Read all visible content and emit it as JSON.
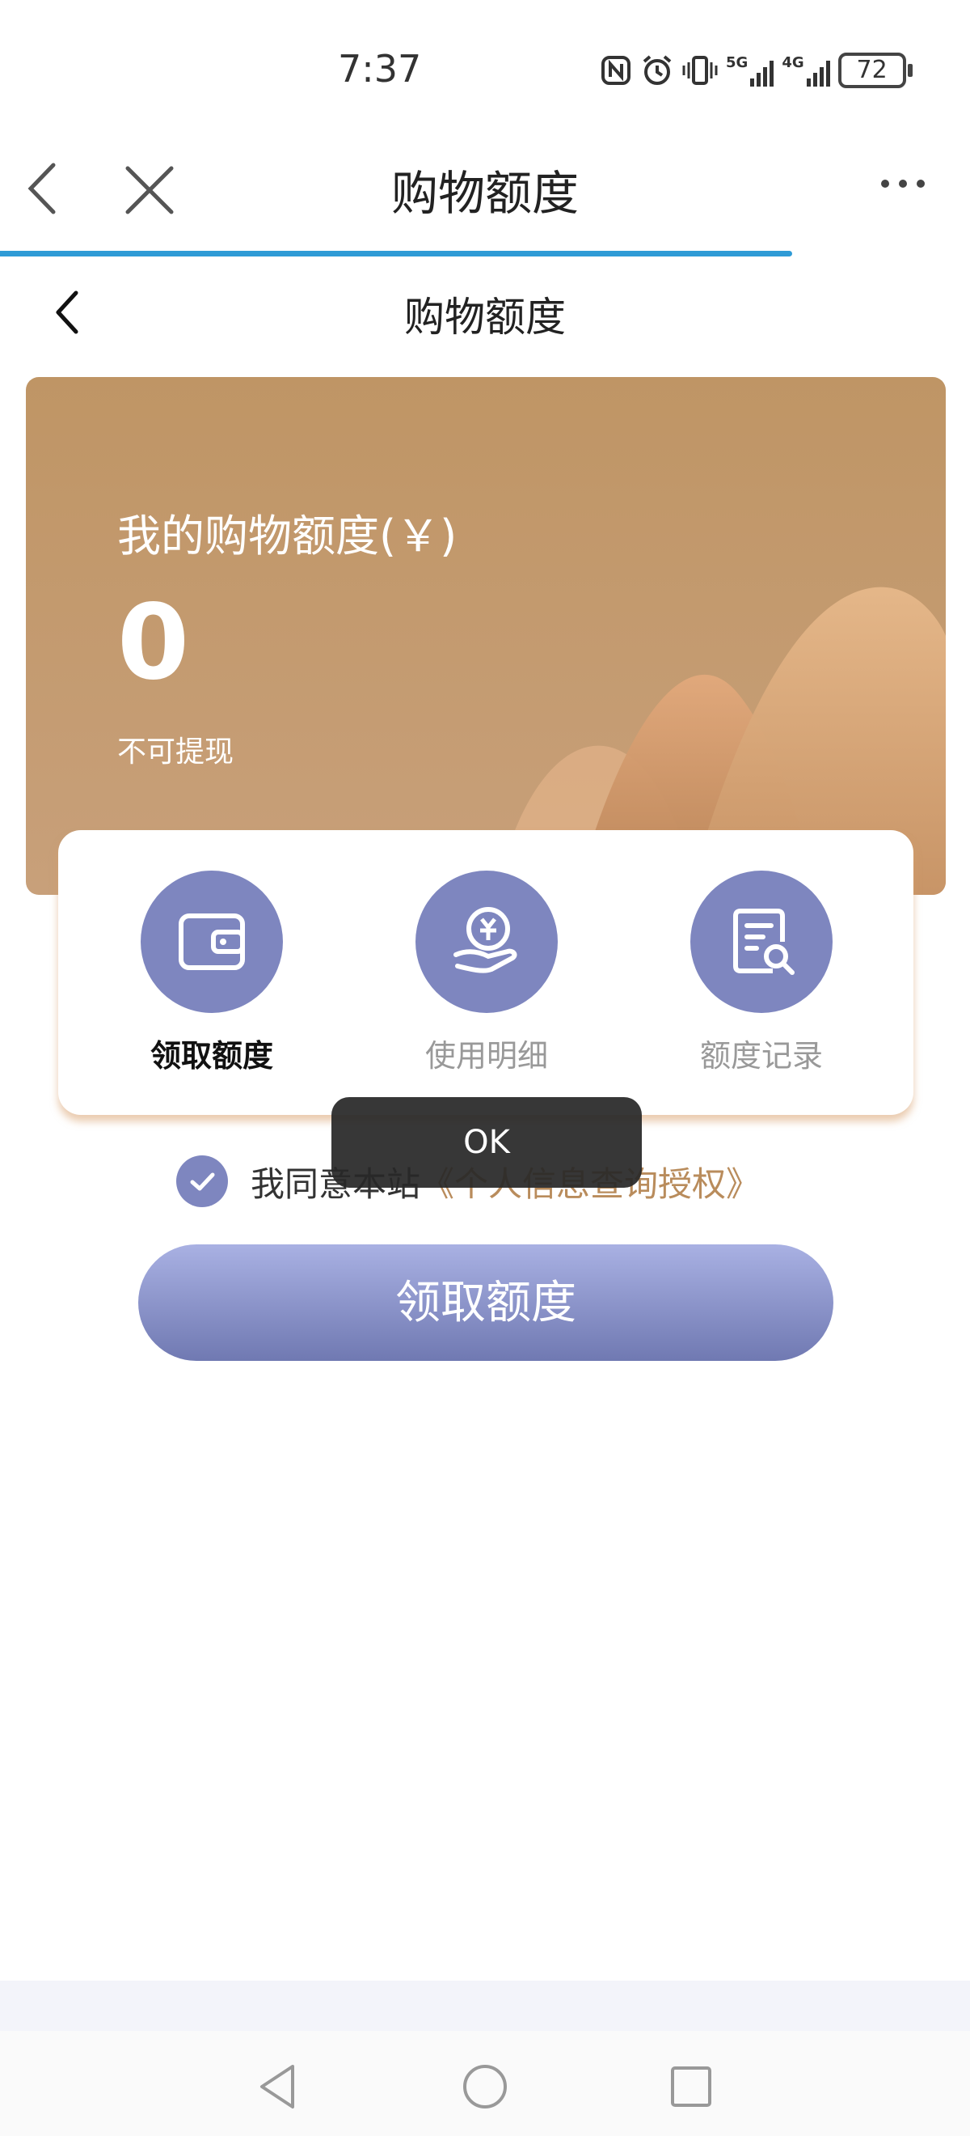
{
  "status_bar": {
    "time": "7:37",
    "battery": "72",
    "net_5g": "5G",
    "net_4g": "4G",
    "icons": [
      "nfc-icon",
      "alarm-icon",
      "vibrate-icon",
      "signal-5g-icon",
      "signal-4g-icon",
      "battery-icon"
    ]
  },
  "top_nav": {
    "title": "购物额度",
    "icons": [
      "back-icon",
      "close-icon",
      "more-icon"
    ]
  },
  "page_header": {
    "title": "购物额度"
  },
  "banner": {
    "label": "我的购物额度(￥)",
    "amount": "0",
    "note": "不可提现",
    "color": "#c19769"
  },
  "actions": [
    {
      "label": "领取额度",
      "icon": "wallet-icon",
      "active": true
    },
    {
      "label": "使用明细",
      "icon": "yuan-hand-icon",
      "active": false
    },
    {
      "label": "额度记录",
      "icon": "document-search-icon",
      "active": false
    }
  ],
  "toast": {
    "text": "OK"
  },
  "agreement": {
    "prefix": "我同意本站",
    "link": "《个人信息查询授权》",
    "checked": true
  },
  "main_button": {
    "label": "领取额度",
    "color": "#7e86bf"
  },
  "system_nav": {
    "icons": [
      "back-triangle-icon",
      "home-circle-icon",
      "recents-square-icon"
    ]
  }
}
